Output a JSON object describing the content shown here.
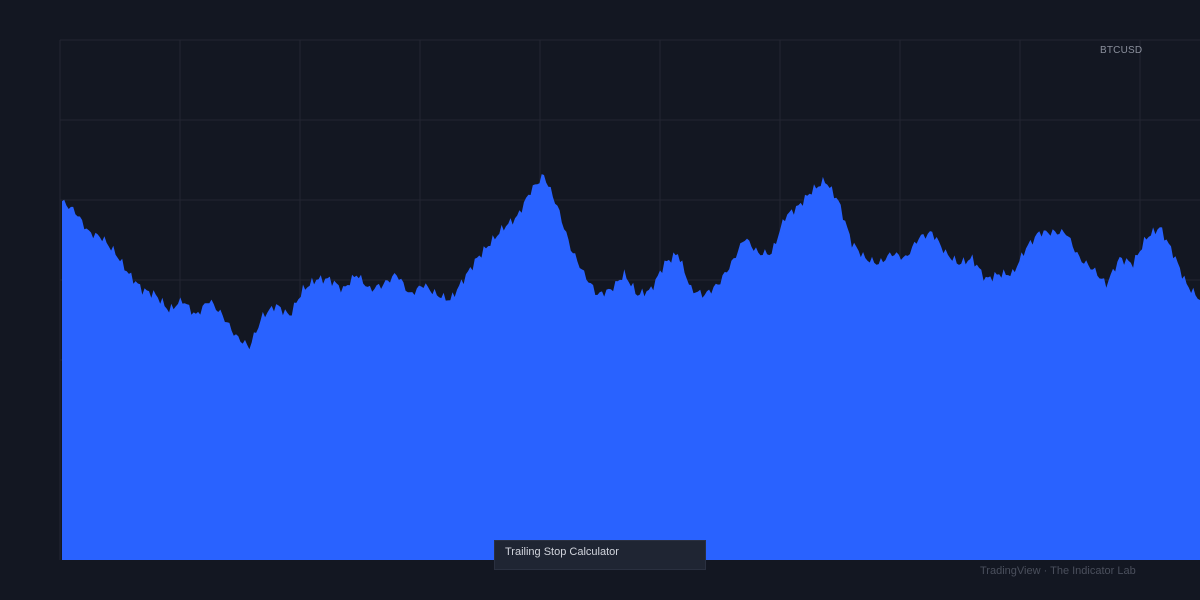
{
  "chart_data": {
    "type": "area",
    "symbol": "BTCUSD",
    "ylim": [
      0,
      100
    ],
    "grid": true,
    "color": "#2962ff",
    "background": "#131722",
    "gridColor": "#232632",
    "values": [
      69,
      67,
      63,
      62,
      59,
      55,
      52,
      51,
      48,
      50,
      47,
      50,
      47,
      43,
      41,
      47,
      49,
      47,
      52,
      54,
      54,
      52,
      55,
      52,
      53,
      55,
      51,
      53,
      51,
      50,
      54,
      58,
      61,
      64,
      66,
      71,
      74,
      68,
      60,
      55,
      51,
      52,
      55,
      51,
      52,
      57,
      59,
      52,
      51,
      53,
      57,
      62,
      59,
      59,
      66,
      68,
      71,
      73,
      69,
      61,
      58,
      57,
      59,
      58,
      62,
      63,
      59,
      57,
      58,
      54,
      55,
      55,
      60,
      63,
      63,
      63,
      58,
      56,
      53,
      58,
      57,
      62,
      64,
      59,
      53,
      50
    ]
  },
  "labels": {
    "symbol": "BTCUSD",
    "indicator": "Trailing Stop Calculator",
    "watermark": "TradingView · The Indicator Lab"
  }
}
